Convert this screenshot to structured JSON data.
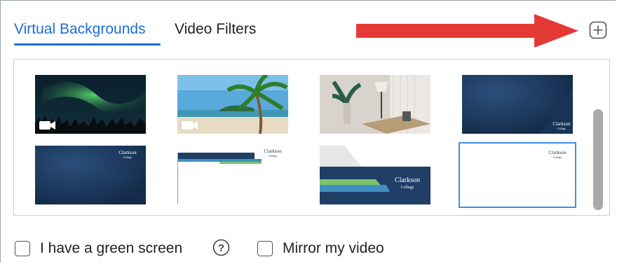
{
  "tabs": {
    "virtual_backgrounds": "Virtual Backgrounds",
    "video_filters": "Video Filters"
  },
  "toolbar": {
    "add_icon": "plus-square-icon"
  },
  "annotation": {
    "arrow_color": "#e53935"
  },
  "backgrounds": [
    {
      "name": "Northern Lights",
      "type": "video"
    },
    {
      "name": "Beach",
      "type": "video"
    },
    {
      "name": "Office Room",
      "type": "image"
    },
    {
      "name": "Clarkson Blue Corner",
      "type": "image",
      "logo": "Clarkson College"
    },
    {
      "name": "Clarkson Blue Top",
      "type": "image",
      "logo": "Clarkson College"
    },
    {
      "name": "Clarkson White Banner",
      "type": "image",
      "logo": "Clarkson College"
    },
    {
      "name": "Clarkson Stripes",
      "type": "image",
      "logo": "Clarkson College"
    },
    {
      "name": "Clarkson White",
      "type": "image",
      "logo": "Clarkson College",
      "selected": true
    }
  ],
  "options": {
    "green_screen": {
      "label": "I have a green screen",
      "checked": false
    },
    "mirror_video": {
      "label": "Mirror my video",
      "checked": false
    }
  },
  "colors": {
    "accent": "#1a6fd3",
    "selection": "#3d8ef0",
    "brand_navy": "#1a3557"
  }
}
